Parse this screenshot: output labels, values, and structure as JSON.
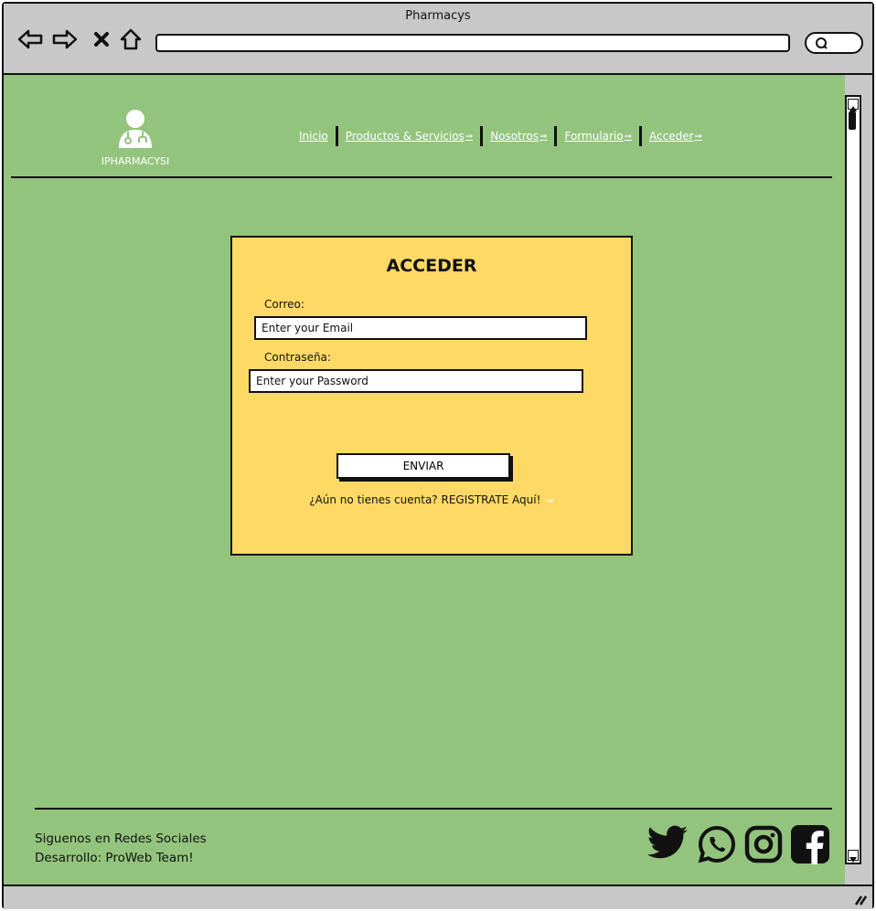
{
  "browser": {
    "title": "Pharmacys",
    "url": "",
    "icons": [
      "back-arrow-icon",
      "forward-arrow-icon",
      "close-icon",
      "home-icon",
      "search-icon"
    ]
  },
  "header": {
    "logo_text": "IPHARMACYSI",
    "menu": [
      {
        "label": "Inicio",
        "arrow": false
      },
      {
        "label": "Productos & Servicios",
        "arrow": true
      },
      {
        "label": "Nosotros",
        "arrow": true
      },
      {
        "label": "Formulario",
        "arrow": true
      },
      {
        "label": "Acceder",
        "arrow": true
      }
    ]
  },
  "login": {
    "title": "ACCEDER",
    "email_label": "Correo:",
    "email_placeholder": "Enter your Email",
    "password_label": "Contraseña:",
    "password_placeholder": "Enter your Password",
    "submit_label": "ENVIAR",
    "register_text": "¿Aún no tienes cuenta? REGISTRATE Aquí!"
  },
  "footer": {
    "line1": "Siguenos en Redes Sociales",
    "line2": "Desarrollo: ProWeb Team!",
    "social_icons": [
      "twitter-icon",
      "whatsapp-icon",
      "instagram-icon",
      "facebook-icon"
    ]
  },
  "colors": {
    "page_bg": "#93c47d",
    "card_bg": "#ffd966",
    "chrome_bg": "#c8c8c8"
  }
}
